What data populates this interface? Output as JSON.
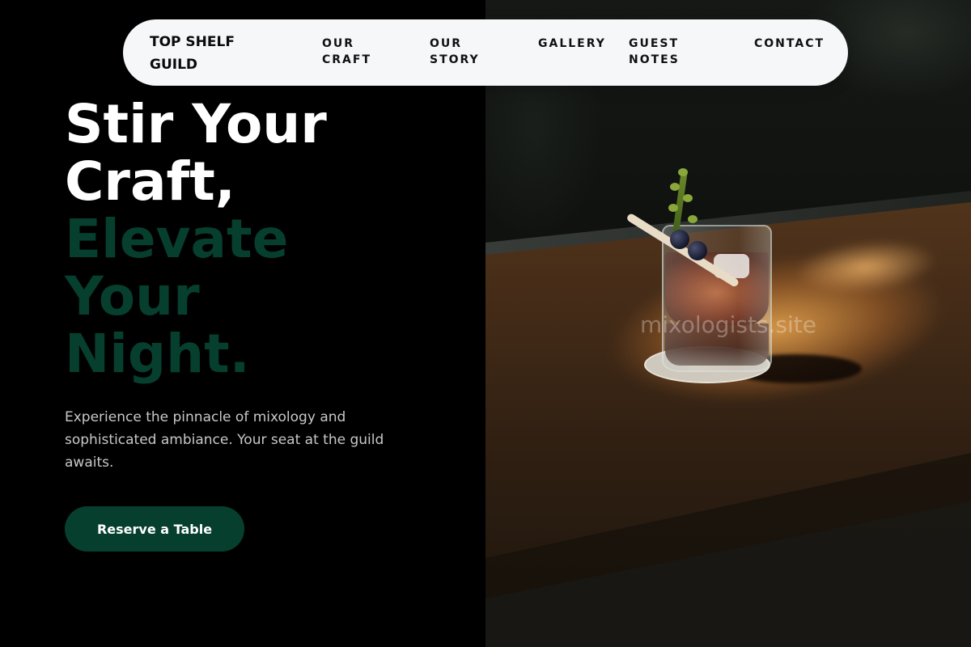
{
  "nav": {
    "logo": "TOP SHELF\nGUILD",
    "links": {
      "craft": "OUR\nCRAFT",
      "story": "OUR\nSTORY",
      "gallery": "GALLERY",
      "notes": "GUEST\nNOTES",
      "contact": "CONTACT"
    }
  },
  "hero": {
    "headline_line1": "Stir Your",
    "headline_line2": "Craft,",
    "headline_line3": "Elevate",
    "headline_line4": "Your",
    "headline_line5": "Night.",
    "subtext": "Experience the pinnacle of mixology and sophisticated ambiance. Your seat at the guild awaits.",
    "cta_label": "Reserve a Table"
  },
  "image": {
    "watermark": "mixologists.site"
  },
  "colors": {
    "accent_green": "#063f2d",
    "nav_bg": "#f6f7f9",
    "page_bg": "#000000"
  }
}
